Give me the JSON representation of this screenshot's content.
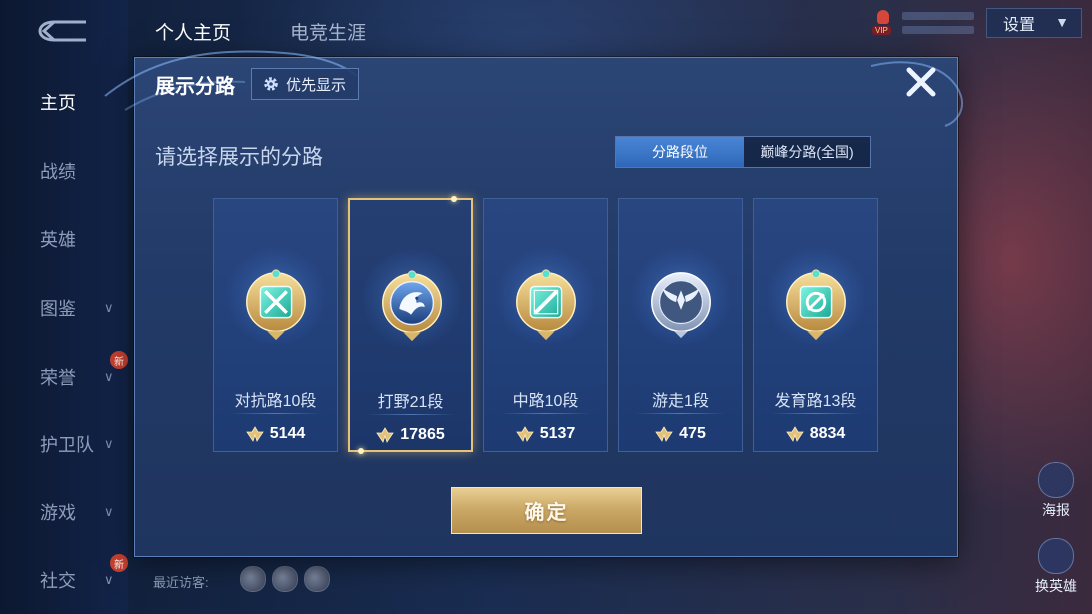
{
  "nav": {
    "items": [
      {
        "label": "主页",
        "active": true,
        "chevron": false,
        "new": false
      },
      {
        "label": "战绩",
        "active": false,
        "chevron": false,
        "new": false
      },
      {
        "label": "英雄",
        "active": false,
        "chevron": false,
        "new": false
      },
      {
        "label": "图鉴",
        "active": false,
        "chevron": true,
        "new": false
      },
      {
        "label": "荣誉",
        "active": false,
        "chevron": true,
        "new": true
      },
      {
        "label": "护卫队",
        "active": false,
        "chevron": true,
        "new": false
      },
      {
        "label": "游戏",
        "active": false,
        "chevron": true,
        "new": false
      },
      {
        "label": "社交",
        "active": false,
        "chevron": true,
        "new": true
      }
    ],
    "new_badge": "新"
  },
  "top_tabs": [
    {
      "label": "个人主页",
      "active": true
    },
    {
      "label": "电竞生涯",
      "active": false
    }
  ],
  "vip": {
    "label": "VIP"
  },
  "settings": {
    "label": "设置"
  },
  "recent_visitors": {
    "label": "最近访客:"
  },
  "side_buttons": {
    "poster": "海报",
    "change_hero": "换英雄"
  },
  "modal": {
    "title": "展示分路",
    "priority_button": "优先显示",
    "subtitle": "请选择展示的分路",
    "segments": [
      "分路段位",
      "巅峰分路(全国)"
    ],
    "selected_segment": 0,
    "confirm": "确定",
    "cards": [
      {
        "name": "对抗路10段",
        "score": "5144",
        "icon": "clash-lane-emblem-icon",
        "selected": false
      },
      {
        "name": "打野21段",
        "score": "17865",
        "icon": "jungle-dragon-emblem-icon",
        "selected": true
      },
      {
        "name": "中路10段",
        "score": "5137",
        "icon": "mid-lane-emblem-icon",
        "selected": false
      },
      {
        "name": "游走1段",
        "score": "475",
        "icon": "roam-wings-emblem-icon",
        "selected": false
      },
      {
        "name": "发育路13段",
        "score": "8834",
        "icon": "farm-lane-emblem-icon",
        "selected": false
      }
    ]
  },
  "colors": {
    "accent_blue": "#3f7fd0",
    "gold": "#c9a664",
    "selected_border": "#e4c27a",
    "panel": "#223a67"
  }
}
